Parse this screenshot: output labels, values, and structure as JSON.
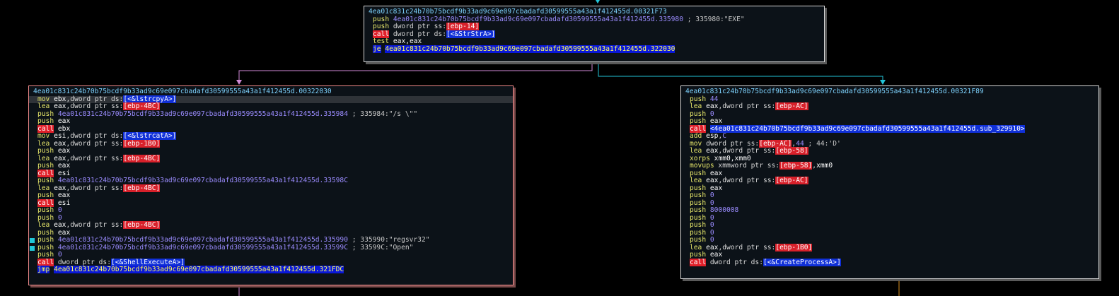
{
  "colors": {
    "background": "#000000",
    "block_bg": "#0c1218",
    "edge_false": "#d28ad8",
    "edge_true": "#22c4d8",
    "edge_other": "#d89020"
  },
  "blocks": [
    {
      "title": "4ea01c831c24b70b75bcdf9b33ad9c69e097cbadafd30599555a43a1f412455d.00321F73",
      "selected": false,
      "lines": [
        {
          "t": [
            [
              "mn",
              "push"
            ],
            [
              "op",
              " "
            ],
            [
              "addr",
              "4ea01c831c24b70b75bcdf9b33ad9c69e097cbadafd30599555a43a1f412455d.335980"
            ],
            [
              "cmt",
              " ; 335980:\"EXE\""
            ]
          ]
        },
        {
          "t": [
            [
              "mn",
              "push"
            ],
            [
              "op",
              " dword ptr ss:"
            ],
            [
              "br",
              "[ebp-14]"
            ]
          ]
        },
        {
          "t": [
            [
              "mn-call",
              "call"
            ],
            [
              "op",
              " dword ptr ds:"
            ],
            [
              "api",
              "[<&StrStrA>]"
            ]
          ]
        },
        {
          "t": [
            [
              "mn",
              "test"
            ],
            [
              "op",
              " "
            ],
            [
              "reg",
              "eax,eax"
            ]
          ]
        },
        {
          "t": [
            [
              "mn-jmp",
              "je"
            ],
            [
              "op",
              " "
            ],
            [
              "mn-jmp",
              "4ea01c831c24b70b75bcdf9b33ad9c69e097cbadafd30599555a43a1f412455d.322030"
            ]
          ]
        }
      ]
    },
    {
      "title": "4ea01c831c24b70b75bcdf9b33ad9c69e097cbadafd30599555a43a1f412455d.00322030",
      "selected": true,
      "lines": [
        {
          "hl": true,
          "t": [
            [
              "mn",
              "mov"
            ],
            [
              "op",
              " "
            ],
            [
              "reg",
              "ebx"
            ],
            [
              "op",
              ",dword ptr ds:"
            ],
            [
              "api",
              "[<&lstrcpyA>]"
            ]
          ]
        },
        {
          "t": [
            [
              "mn",
              "lea"
            ],
            [
              "op",
              " "
            ],
            [
              "reg",
              "eax"
            ],
            [
              "op",
              ",dword ptr ss:"
            ],
            [
              "br",
              "[ebp-4BC]"
            ]
          ]
        },
        {
          "t": [
            [
              "mn",
              "push"
            ],
            [
              "op",
              " "
            ],
            [
              "addr",
              "4ea01c831c24b70b75bcdf9b33ad9c69e097cbadafd30599555a43a1f412455d.335984"
            ],
            [
              "cmt",
              " ; 335984:\"/s \\\"\""
            ]
          ]
        },
        {
          "t": [
            [
              "mn",
              "push"
            ],
            [
              "op",
              " "
            ],
            [
              "reg",
              "eax"
            ]
          ]
        },
        {
          "t": [
            [
              "mn-call",
              "call"
            ],
            [
              "op",
              " "
            ],
            [
              "reg",
              "ebx"
            ]
          ]
        },
        {
          "t": [
            [
              "mn",
              "mov"
            ],
            [
              "op",
              " "
            ],
            [
              "reg",
              "esi"
            ],
            [
              "op",
              ",dword ptr ds:"
            ],
            [
              "api",
              "[<&lstrcatA>]"
            ]
          ]
        },
        {
          "t": [
            [
              "mn",
              "lea"
            ],
            [
              "op",
              " "
            ],
            [
              "reg",
              "eax"
            ],
            [
              "op",
              ",dword ptr ss:"
            ],
            [
              "br",
              "[ebp-1B0]"
            ]
          ]
        },
        {
          "t": [
            [
              "mn",
              "push"
            ],
            [
              "op",
              " "
            ],
            [
              "reg",
              "eax"
            ]
          ]
        },
        {
          "t": [
            [
              "mn",
              "lea"
            ],
            [
              "op",
              " "
            ],
            [
              "reg",
              "eax"
            ],
            [
              "op",
              ",dword ptr ss:"
            ],
            [
              "br",
              "[ebp-4BC]"
            ]
          ]
        },
        {
          "t": [
            [
              "mn",
              "push"
            ],
            [
              "op",
              " "
            ],
            [
              "reg",
              "eax"
            ]
          ]
        },
        {
          "t": [
            [
              "mn-call",
              "call"
            ],
            [
              "op",
              " "
            ],
            [
              "reg",
              "esi"
            ]
          ]
        },
        {
          "t": [
            [
              "mn",
              "push"
            ],
            [
              "op",
              " "
            ],
            [
              "addr",
              "4ea01c831c24b70b75bcdf9b33ad9c69e097cbadafd30599555a43a1f412455d.33598C"
            ]
          ]
        },
        {
          "t": [
            [
              "mn",
              "lea"
            ],
            [
              "op",
              " "
            ],
            [
              "reg",
              "eax"
            ],
            [
              "op",
              ",dword ptr ss:"
            ],
            [
              "br",
              "[ebp-4BC]"
            ]
          ]
        },
        {
          "t": [
            [
              "mn",
              "push"
            ],
            [
              "op",
              " "
            ],
            [
              "reg",
              "eax"
            ]
          ]
        },
        {
          "t": [
            [
              "mn-call",
              "call"
            ],
            [
              "op",
              " "
            ],
            [
              "reg",
              "esi"
            ]
          ]
        },
        {
          "t": [
            [
              "mn",
              "push"
            ],
            [
              "op",
              " "
            ],
            [
              "num",
              "0"
            ]
          ]
        },
        {
          "t": [
            [
              "mn",
              "push"
            ],
            [
              "op",
              " "
            ],
            [
              "num",
              "0"
            ]
          ]
        },
        {
          "t": [
            [
              "mn",
              "lea"
            ],
            [
              "op",
              " "
            ],
            [
              "reg",
              "eax"
            ],
            [
              "op",
              ",dword ptr ss:"
            ],
            [
              "br",
              "[ebp-4BC]"
            ]
          ]
        },
        {
          "t": [
            [
              "mn",
              "push"
            ],
            [
              "op",
              " "
            ],
            [
              "reg",
              "eax"
            ]
          ]
        },
        {
          "mark": true,
          "t": [
            [
              "mn",
              "push"
            ],
            [
              "op",
              " "
            ],
            [
              "addr",
              "4ea01c831c24b70b75bcdf9b33ad9c69e097cbadafd30599555a43a1f412455d.335990"
            ],
            [
              "cmt",
              " ; 335990:\"regsvr32\""
            ]
          ]
        },
        {
          "mark": true,
          "t": [
            [
              "mn",
              "push"
            ],
            [
              "op",
              " "
            ],
            [
              "addr",
              "4ea01c831c24b70b75bcdf9b33ad9c69e097cbadafd30599555a43a1f412455d.33599C"
            ],
            [
              "cmt",
              " ; 33599C:\"Open\""
            ]
          ]
        },
        {
          "t": [
            [
              "mn",
              "push"
            ],
            [
              "op",
              " "
            ],
            [
              "num",
              "0"
            ]
          ]
        },
        {
          "t": [
            [
              "mn-call",
              "call"
            ],
            [
              "op",
              " dword ptr ds:"
            ],
            [
              "api",
              "[<&ShellExecuteA>]"
            ]
          ]
        },
        {
          "t": [
            [
              "mn-jmp",
              "jmp"
            ],
            [
              "op",
              " "
            ],
            [
              "mn-jmp",
              "4ea01c831c24b70b75bcdf9b33ad9c69e097cbadafd30599555a43a1f412455d.321FDC"
            ]
          ]
        }
      ]
    },
    {
      "title": "4ea01c831c24b70b75bcdf9b33ad9c69e097cbadafd30599555a43a1f412455d.00321F89",
      "selected": false,
      "lines": [
        {
          "t": [
            [
              "mn",
              "push"
            ],
            [
              "op",
              " "
            ],
            [
              "num",
              "44"
            ]
          ]
        },
        {
          "t": [
            [
              "mn",
              "lea"
            ],
            [
              "op",
              " "
            ],
            [
              "reg",
              "eax"
            ],
            [
              "op",
              ",dword ptr ss:"
            ],
            [
              "br",
              "[ebp-AC]"
            ]
          ]
        },
        {
          "t": [
            [
              "mn",
              "push"
            ],
            [
              "op",
              " "
            ],
            [
              "num",
              "0"
            ]
          ]
        },
        {
          "t": [
            [
              "mn",
              "push"
            ],
            [
              "op",
              " "
            ],
            [
              "reg",
              "eax"
            ]
          ]
        },
        {
          "t": [
            [
              "mn-call",
              "call"
            ],
            [
              "op",
              " "
            ],
            [
              "api",
              "<4ea01c831c24b70b75bcdf9b33ad9c69e097cbadafd30599555a43a1f412455d.sub_329910>"
            ]
          ]
        },
        {
          "t": [
            [
              "mn",
              "add"
            ],
            [
              "op",
              " "
            ],
            [
              "reg",
              "esp"
            ],
            [
              "op",
              ","
            ],
            [
              "num",
              "C"
            ]
          ]
        },
        {
          "t": [
            [
              "mn",
              "mov"
            ],
            [
              "op",
              " dword ptr ss:"
            ],
            [
              "br",
              "[ebp-AC]"
            ],
            [
              "op",
              ","
            ],
            [
              "num",
              "44"
            ],
            [
              "cmt",
              " ; 44:'D'"
            ]
          ]
        },
        {
          "t": [
            [
              "mn",
              "lea"
            ],
            [
              "op",
              " "
            ],
            [
              "reg",
              "eax"
            ],
            [
              "op",
              ",dword ptr ss:"
            ],
            [
              "br",
              "[ebp-58]"
            ]
          ]
        },
        {
          "t": [
            [
              "mn",
              "xorps"
            ],
            [
              "op",
              " "
            ],
            [
              "reg",
              "xmm0,xmm0"
            ]
          ]
        },
        {
          "t": [
            [
              "mn",
              "movups"
            ],
            [
              "op",
              " xmmword ptr ss:"
            ],
            [
              "br",
              "[ebp-58]"
            ],
            [
              "op",
              ","
            ],
            [
              "reg",
              "xmm0"
            ]
          ]
        },
        {
          "t": [
            [
              "mn",
              "push"
            ],
            [
              "op",
              " "
            ],
            [
              "reg",
              "eax"
            ]
          ]
        },
        {
          "t": [
            [
              "mn",
              "lea"
            ],
            [
              "op",
              " "
            ],
            [
              "reg",
              "eax"
            ],
            [
              "op",
              ",dword ptr ss:"
            ],
            [
              "br",
              "[ebp-AC]"
            ]
          ]
        },
        {
          "t": [
            [
              "mn",
              "push"
            ],
            [
              "op",
              " "
            ],
            [
              "reg",
              "eax"
            ]
          ]
        },
        {
          "t": [
            [
              "mn",
              "push"
            ],
            [
              "op",
              " "
            ],
            [
              "num",
              "0"
            ]
          ]
        },
        {
          "t": [
            [
              "mn",
              "push"
            ],
            [
              "op",
              " "
            ],
            [
              "num",
              "0"
            ]
          ]
        },
        {
          "t": [
            [
              "mn",
              "push"
            ],
            [
              "op",
              " "
            ],
            [
              "num",
              "8000008"
            ]
          ]
        },
        {
          "t": [
            [
              "mn",
              "push"
            ],
            [
              "op",
              " "
            ],
            [
              "num",
              "0"
            ]
          ]
        },
        {
          "t": [
            [
              "mn",
              "push"
            ],
            [
              "op",
              " "
            ],
            [
              "num",
              "0"
            ]
          ]
        },
        {
          "t": [
            [
              "mn",
              "push"
            ],
            [
              "op",
              " "
            ],
            [
              "num",
              "0"
            ]
          ]
        },
        {
          "t": [
            [
              "mn",
              "push"
            ],
            [
              "op",
              " "
            ],
            [
              "num",
              "0"
            ]
          ]
        },
        {
          "t": [
            [
              "mn",
              "lea"
            ],
            [
              "op",
              " "
            ],
            [
              "reg",
              "eax"
            ],
            [
              "op",
              ",dword ptr ss:"
            ],
            [
              "br",
              "[ebp-1B0]"
            ]
          ]
        },
        {
          "t": [
            [
              "mn",
              "push"
            ],
            [
              "op",
              " "
            ],
            [
              "reg",
              "eax"
            ]
          ]
        },
        {
          "t": [
            [
              "mn-call",
              "call"
            ],
            [
              "op",
              " dword ptr ds:"
            ],
            [
              "api",
              "[<&CreateProcessA>]"
            ]
          ]
        }
      ]
    }
  ]
}
